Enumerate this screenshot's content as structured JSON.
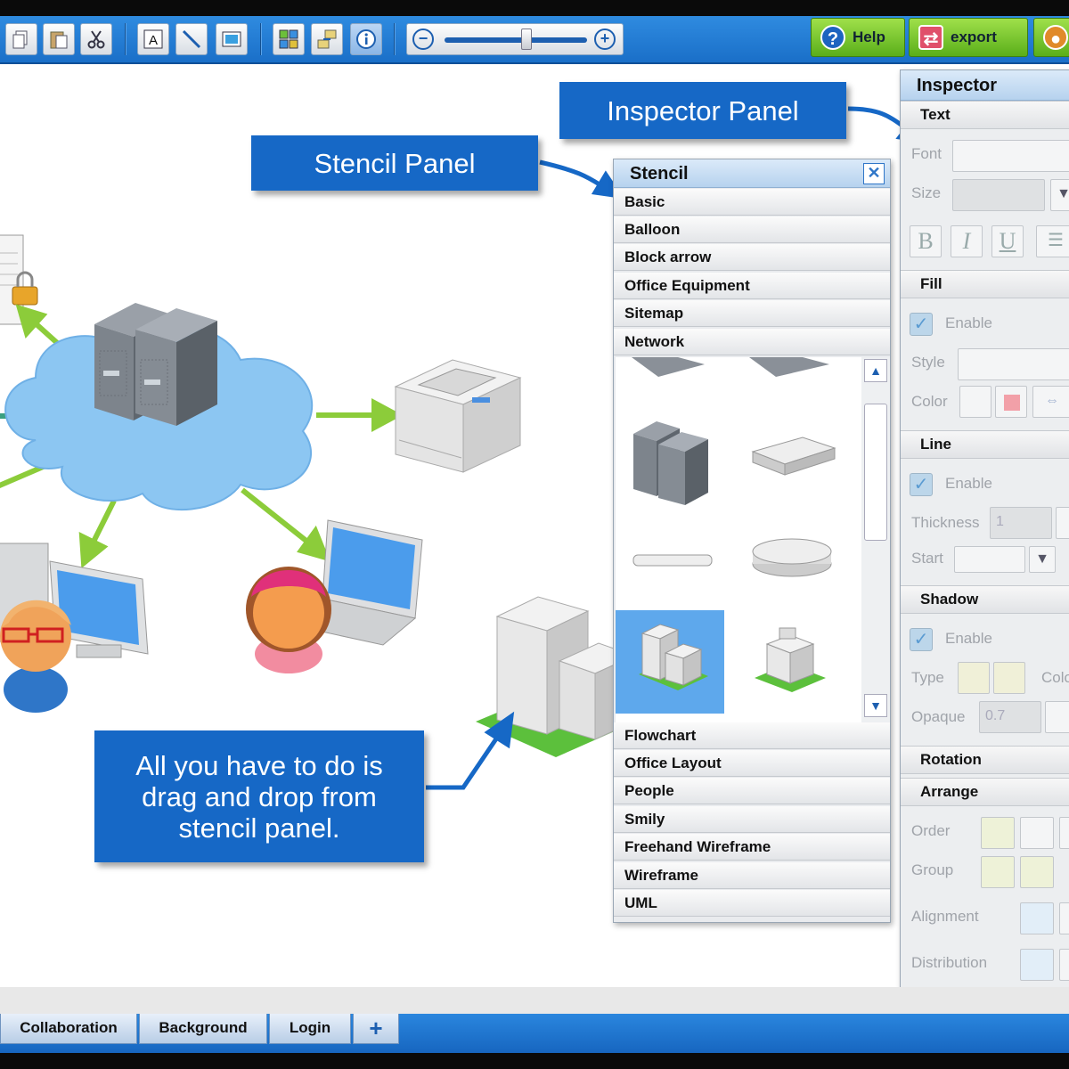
{
  "toolbar": {
    "help_label": "Help",
    "export_label": "export",
    "zoom_level": 0.6,
    "icons": [
      "copy-icon",
      "paste-icon",
      "cut-icon",
      "text-icon",
      "line-icon",
      "image-icon",
      "grid-icon",
      "connect-icon",
      "info-icon",
      "zoom-out-icon",
      "zoom-in-icon"
    ]
  },
  "callouts": {
    "stencil": "Stencil Panel",
    "inspector": "Inspector Panel",
    "instructions": "All you have to do is drag and drop from stencil panel."
  },
  "stencil": {
    "title": "Stencil",
    "categories_top": [
      "Basic",
      "Balloon",
      "Block arrow",
      "Office Equipment",
      "Sitemap",
      "Network"
    ],
    "categories_bottom": [
      "Flowchart",
      "Office Layout",
      "People",
      "Smily",
      "Freehand Wireframe",
      "Wireframe",
      "UML"
    ]
  },
  "inspector": {
    "title": "Inspector",
    "sections": {
      "text": "Text",
      "fill": "Fill",
      "line": "Line",
      "shadow": "Shadow",
      "rotation": "Rotation",
      "arrange": "Arrange"
    },
    "labels": {
      "font": "Font",
      "size": "Size",
      "enable": "Enable",
      "style": "Style",
      "color": "Color",
      "thickness": "Thickness",
      "start": "Start",
      "type": "Type",
      "color_cut": "Colo",
      "opaque": "Opaque",
      "order": "Order",
      "group": "Group",
      "alignment": "Alignment",
      "distribution": "Distribution"
    },
    "values": {
      "thickness": "1",
      "opaque": "0.7"
    },
    "format_buttons": [
      "B",
      "I",
      "U"
    ]
  },
  "bottom_tabs": [
    "Collaboration",
    "Background",
    "Login"
  ],
  "add_tab_label": "+"
}
